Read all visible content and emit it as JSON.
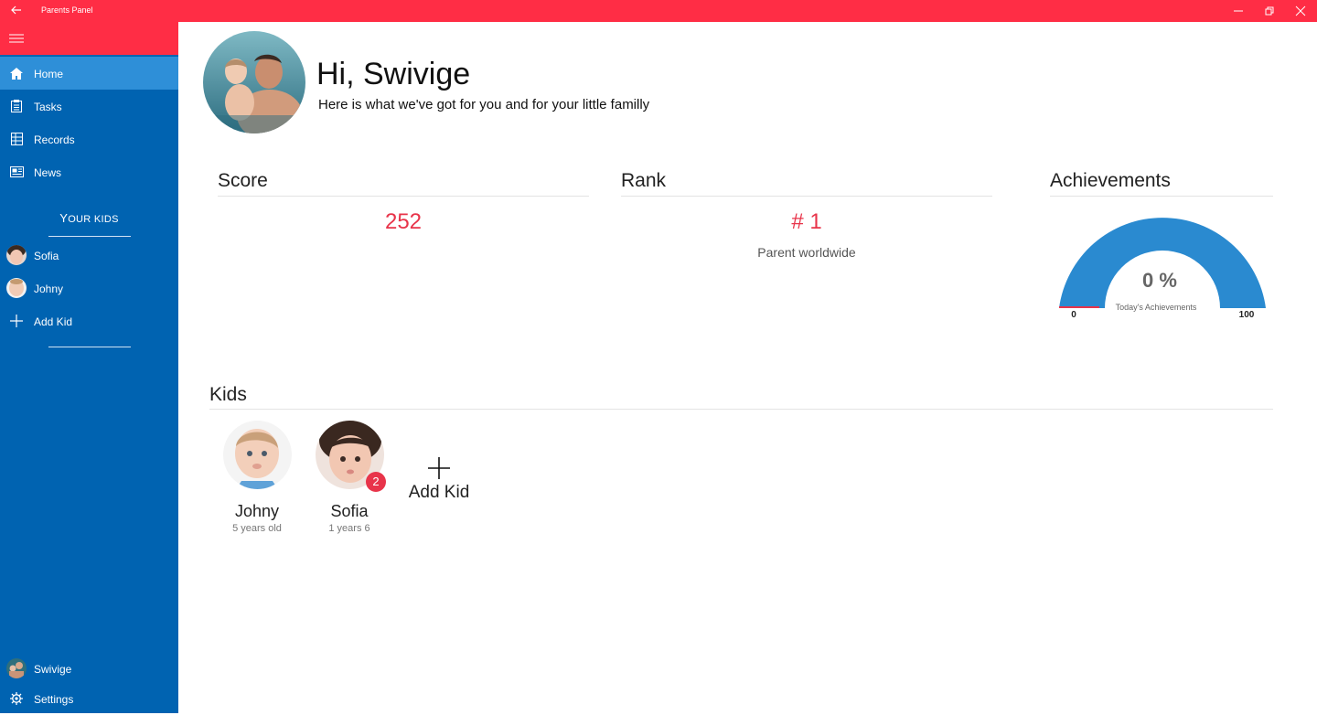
{
  "window": {
    "title": "Parents Panel",
    "accent": "#ff2d45",
    "sidebar_color": "#0063b1",
    "active_item_color": "#2e8fd8"
  },
  "sidebar": {
    "menu_icon": "hamburger-icon",
    "nav": [
      {
        "label": "Home",
        "icon": "home-icon",
        "active": true
      },
      {
        "label": "Tasks",
        "icon": "clipboard-icon",
        "active": false
      },
      {
        "label": "Records",
        "icon": "records-icon",
        "active": false
      },
      {
        "label": "News",
        "icon": "news-icon",
        "active": false
      }
    ],
    "kids_section_first": "Y",
    "kids_section_rest": "OUR KIDS",
    "kids": [
      {
        "label": "Sofia"
      },
      {
        "label": "Johny"
      }
    ],
    "add_kid_label": "Add Kid",
    "user_label": "Swivige",
    "settings_label": "Settings"
  },
  "header": {
    "greeting": "Hi,  Swivige",
    "subtitle": "Here is what we've got for you and for your little familly"
  },
  "stats": {
    "score": {
      "heading": "Score",
      "value": "252"
    },
    "rank": {
      "heading": "Rank",
      "value": "# 1",
      "note": "Parent worldwide"
    },
    "achievements": {
      "heading": "Achievements",
      "percent_label": "0 %",
      "percent": 0,
      "caption": "Today's Achievements",
      "min_label": "0",
      "max_label": "100",
      "gauge_color": "#2a8ad0"
    }
  },
  "kids_panel": {
    "heading": "Kids",
    "kids": [
      {
        "name": "Johny",
        "age": "5 years old",
        "badge": ""
      },
      {
        "name": "Sofia",
        "age": "1 years 6",
        "badge": "2"
      }
    ],
    "add_label": "Add Kid"
  }
}
